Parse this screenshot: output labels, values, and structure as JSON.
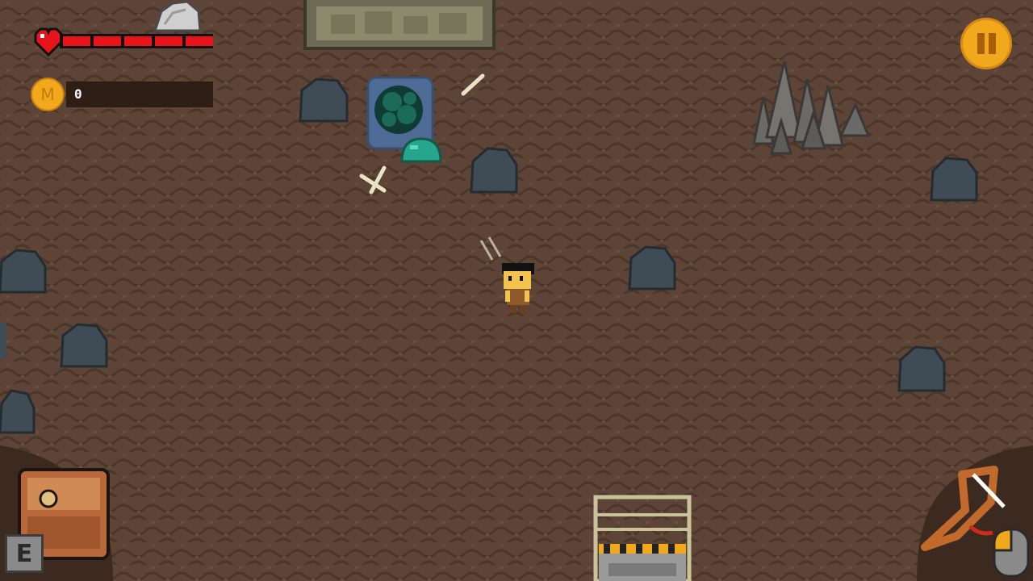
{
  "hud": {
    "health": {
      "segments_total": 5,
      "segments_filled": 5,
      "color": "#e8141b"
    },
    "coins": {
      "icon_letter": "M",
      "count": "0"
    },
    "pause": {
      "icon": "pause-icon"
    }
  },
  "controls": {
    "inventory": {
      "icon": "backpack-icon"
    },
    "inventory_key": {
      "label": "E"
    },
    "weapon": {
      "icon": "slingshot-icon",
      "mouse_hint": "mouse-left-click-icon"
    }
  },
  "colors": {
    "ground": "#5e4436",
    "ground_dark": "#4b362a",
    "coin": "#f2a81d",
    "slime": "#26a68c",
    "rock": "#3f4c55"
  }
}
